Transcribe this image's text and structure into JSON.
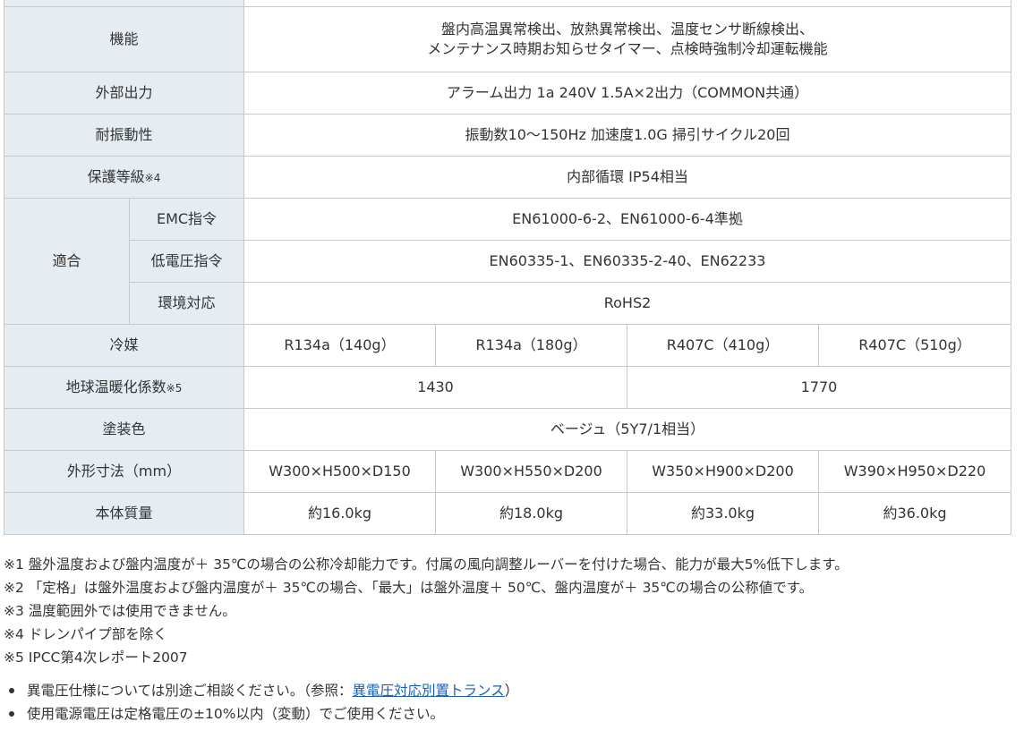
{
  "spec_table": {
    "function": {
      "label": "機能",
      "line1": "盤内高温異常検出、放熱異常検出、温度センサ断線検出、",
      "line2": "メンテナンス時期お知らせタイマー、点検時強制冷却運転機能"
    },
    "external_output": {
      "label": "外部出力",
      "value": "アラーム出力 1a 240V 1.5A×2出力（COMMON共通）"
    },
    "vibration": {
      "label": "耐振動性",
      "value": "振動数10～150Hz 加速度1.0G 掃引サイクル20回"
    },
    "protection": {
      "label": "保護等級",
      "note": "※4",
      "value": "内部循環 IP54相当"
    },
    "compliance": {
      "label": "適合",
      "emc": {
        "label": "EMC指令",
        "value": "EN61000-6-2、EN61000-6-4準拠"
      },
      "low_voltage": {
        "label": "低電圧指令",
        "value": "EN60335-1、EN60335-2-40、EN62233"
      },
      "environment": {
        "label": "環境対応",
        "value": "RoHS2"
      }
    },
    "refrigerant": {
      "label": "冷媒",
      "values": [
        "R134a（140g）",
        "R134a（180g）",
        "R407C（410g）",
        "R407C（510g）"
      ]
    },
    "gwp": {
      "label": "地球温暖化係数",
      "note": "※5",
      "values": [
        "1430",
        "1770"
      ]
    },
    "paint": {
      "label": "塗装色",
      "value": "ベージュ（5Y7/1相当）"
    },
    "dimensions": {
      "label": "外形寸法（mm）",
      "values": [
        "W300×H500×D150",
        "W300×H550×D200",
        "W350×H900×D200",
        "W390×H950×D220"
      ]
    },
    "mass": {
      "label": "本体質量",
      "values": [
        "約16.0kg",
        "約18.0kg",
        "約33.0kg",
        "約36.0kg"
      ]
    }
  },
  "footnotes": [
    "※1 盤外温度および盤内温度が＋ 35℃の場合の公称冷却能力です。付属の風向調整ルーバーを付けた場合、能力が最大5%低下します。",
    "※2 「定格」は盤外温度および盤内温度が＋ 35℃の場合、「最大」は盤外温度＋ 50℃、盤内温度が＋ 35℃の場合の公称値です。",
    "※3 温度範囲外では使用できません。",
    "※4 ドレンパイプ部を除く",
    "※5 IPCC第4次レポート2007"
  ],
  "bullets": {
    "item1_before": "異電圧仕様については別途ご相談ください。（参照：",
    "item1_link": "異電圧対応別置トランス",
    "item1_after": "）",
    "item2": "使用電源電圧は定格電圧の±10%以内（変動）でご使用ください。"
  }
}
